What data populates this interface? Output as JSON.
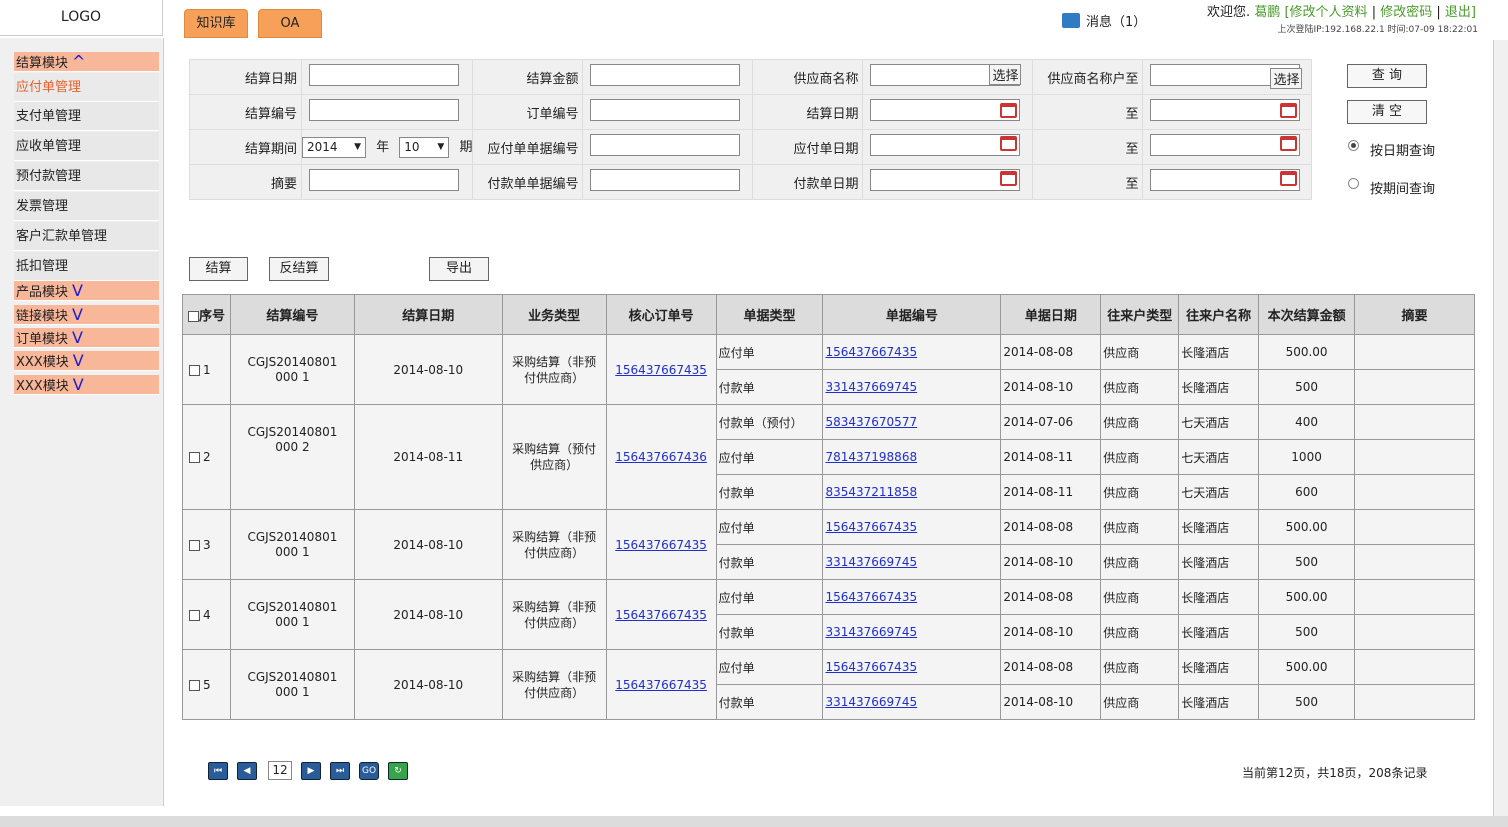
{
  "header": {
    "logo": "LOGO",
    "tabs": [
      "知识库",
      "OA"
    ],
    "message": "消息（1）",
    "welcome_prefix": "欢迎您.",
    "username": "葛鹏",
    "edit_profile": "[修改个人资料",
    "sep1": "|",
    "change_password": "修改密码",
    "sep2": "|",
    "logout": "退出]",
    "last_login": "上次登陆IP:192.168.22.1     时间:07-09 18:22:01"
  },
  "sidebar": {
    "items": [
      {
        "label": "结算模块",
        "mark": "^",
        "type": "module"
      },
      {
        "label": "应付单管理",
        "type": "active"
      },
      {
        "label": "支付单管理",
        "type": "item"
      },
      {
        "label": "应收单管理",
        "type": "item"
      },
      {
        "label": "预付款管理",
        "type": "item"
      },
      {
        "label": "发票管理",
        "type": "item"
      },
      {
        "label": "客户汇款单管理",
        "type": "item"
      },
      {
        "label": "抵扣管理",
        "type": "item"
      },
      {
        "label": "产品模块",
        "mark": "V",
        "type": "module"
      },
      {
        "label": "链接模块",
        "mark": "V",
        "type": "module"
      },
      {
        "label": "订单模块",
        "mark": "V",
        "type": "module"
      },
      {
        "label": "XXX模块",
        "mark": "V",
        "type": "module"
      },
      {
        "label": "XXX模块",
        "mark": "V",
        "type": "module"
      }
    ]
  },
  "filters": {
    "settle_date": "结算日期",
    "settle_amount": "结算金额",
    "supplier_name": "供应商名称",
    "supplier_to": "供应商名称户至",
    "settle_no": "结算编号",
    "order_no": "订单编号",
    "settle_date2": "结算日期",
    "to1": "至",
    "settle_period": "结算期间",
    "year_value": "2014",
    "year_unit": "年",
    "period_value": "10",
    "period_unit": "期",
    "payable_doc_no": "应付单单据编号",
    "payable_date": "应付单日期",
    "to2": "至",
    "summary": "摘要",
    "payment_doc_no": "付款单单据编号",
    "payment_date": "付款单日期",
    "to3": "至",
    "select": "选择"
  },
  "search": {
    "query": "查 询",
    "clear": "清 空",
    "by_date": "按日期查询",
    "by_period": "按期间查询"
  },
  "actions": {
    "settle": "结算",
    "unsettle": "反结算",
    "export": "导出"
  },
  "grid": {
    "headers": [
      "序号",
      "结算编号",
      "结算日期",
      "业务类型",
      "核心订单号",
      "单据类型",
      "单据编号",
      "单据日期",
      "往来户类型",
      "往来户名称",
      "本次结算金额",
      "摘要"
    ],
    "groups": [
      {
        "seq": "1",
        "no": "CGJS20140801000 1",
        "date": "2014-08-10",
        "biz": "采购结算（非预付供应商）",
        "order": "156437667435",
        "rows": [
          {
            "type": "应付单",
            "doc": "156437667435",
            "ddate": "2014-08-08",
            "ptype": "供应商",
            "pname": "长隆酒店",
            "amt": "500.00"
          },
          {
            "type": "付款单",
            "doc": "331437669745",
            "ddate": "2014-08-10",
            "ptype": "供应商",
            "pname": "长隆酒店",
            "amt": "500"
          }
        ]
      },
      {
        "seq": "2",
        "no": "CGJS20140801000 2",
        "date": "2014-08-11",
        "biz": "采购结算（预付供应商）",
        "order": "156437667436",
        "rows": [
          {
            "type": "付款单（预付）",
            "doc": "583437670577",
            "ddate": "2014-07-06",
            "ptype": "供应商",
            "pname": "七天酒店",
            "amt": "400"
          },
          {
            "type": "应付单",
            "doc": "781437198868",
            "ddate": "2014-08-11",
            "ptype": "供应商",
            "pname": "七天酒店",
            "amt": "1000"
          },
          {
            "type": "付款单",
            "doc": "835437211858",
            "ddate": "2014-08-11",
            "ptype": "供应商",
            "pname": "七天酒店",
            "amt": "600"
          }
        ]
      },
      {
        "seq": "3",
        "no": "CGJS20140801000 1",
        "date": "2014-08-10",
        "biz": "采购结算（非预付供应商）",
        "order": "156437667435",
        "rows": [
          {
            "type": "应付单",
            "doc": "156437667435",
            "ddate": "2014-08-08",
            "ptype": "供应商",
            "pname": "长隆酒店",
            "amt": "500.00"
          },
          {
            "type": "付款单",
            "doc": "331437669745",
            "ddate": "2014-08-10",
            "ptype": "供应商",
            "pname": "长隆酒店",
            "amt": "500"
          }
        ]
      },
      {
        "seq": "4",
        "no": "CGJS20140801000 1",
        "date": "2014-08-10",
        "biz": "采购结算（非预付供应商）",
        "order": "156437667435",
        "rows": [
          {
            "type": "应付单",
            "doc": "156437667435",
            "ddate": "2014-08-08",
            "ptype": "供应商",
            "pname": "长隆酒店",
            "amt": "500.00"
          },
          {
            "type": "付款单",
            "doc": "331437669745",
            "ddate": "2014-08-10",
            "ptype": "供应商",
            "pname": "长隆酒店",
            "amt": "500"
          }
        ]
      },
      {
        "seq": "5",
        "no": "CGJS20140801000 1",
        "date": "2014-08-10",
        "biz": "采购结算（非预付供应商）",
        "order": "156437667435",
        "rows": [
          {
            "type": "应付单",
            "doc": "156437667435",
            "ddate": "2014-08-08",
            "ptype": "供应商",
            "pname": "长隆酒店",
            "amt": "500.00"
          },
          {
            "type": "付款单",
            "doc": "331437669745",
            "ddate": "2014-08-10",
            "ptype": "供应商",
            "pname": "长隆酒店",
            "amt": "500"
          }
        ]
      }
    ]
  },
  "pager": {
    "page": "12",
    "go": "GO",
    "info": "当前第12页，共18页，208条记录"
  },
  "colors": {
    "accent": "#f7a05a",
    "module": "#f9b79a",
    "link": "#1f2fcc",
    "green": "#4a9a2a"
  }
}
